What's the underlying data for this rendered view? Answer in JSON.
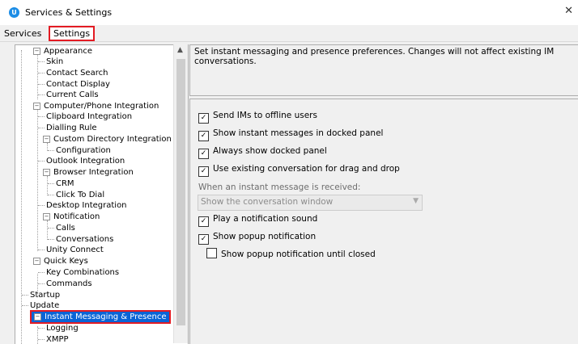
{
  "window": {
    "title": "Services & Settings",
    "close_label": "✕",
    "app_icon_letter": "U"
  },
  "tabs": [
    {
      "label": "Services"
    },
    {
      "label": "Settings"
    }
  ],
  "tree": {
    "items": [
      {
        "label": "Appearance"
      },
      {
        "label": "Skin"
      },
      {
        "label": "Contact Search"
      },
      {
        "label": "Contact Display"
      },
      {
        "label": "Current Calls"
      },
      {
        "label": "Computer/Phone Integration"
      },
      {
        "label": "Clipboard Integration"
      },
      {
        "label": "Dialling Rule"
      },
      {
        "label": "Custom Directory Integration"
      },
      {
        "label": "Configuration"
      },
      {
        "label": "Outlook Integration"
      },
      {
        "label": "Browser Integration"
      },
      {
        "label": "CRM"
      },
      {
        "label": "Click To Dial"
      },
      {
        "label": "Desktop Integration"
      },
      {
        "label": "Notification"
      },
      {
        "label": "Calls"
      },
      {
        "label": "Conversations"
      },
      {
        "label": "Unity Connect"
      },
      {
        "label": "Quick Keys"
      },
      {
        "label": "Key Combinations"
      },
      {
        "label": "Commands"
      },
      {
        "label": "Startup"
      },
      {
        "label": "Update"
      },
      {
        "label": "Instant Messaging & Presence"
      },
      {
        "label": "Logging"
      },
      {
        "label": "XMPP"
      }
    ]
  },
  "description": "Set instant messaging and presence preferences.  Changes will not affect existing IM conversations.",
  "options": {
    "send_offline": {
      "label": "Send IMs to offline users",
      "checked": true
    },
    "docked_panel": {
      "label": "Show instant messages in docked panel",
      "checked": true
    },
    "always_docked": {
      "label": "Always show docked panel",
      "checked": true
    },
    "existing_conv": {
      "label": "Use existing conversation for drag and drop",
      "checked": true
    },
    "received_label": "When an instant message is received:",
    "received_select": "Show the conversation window",
    "play_sound": {
      "label": "Play a notification sound",
      "checked": true
    },
    "popup": {
      "label": "Show popup notification",
      "checked": true
    },
    "popup_until_closed": {
      "label": "Show popup notification until closed",
      "checked": false
    }
  }
}
